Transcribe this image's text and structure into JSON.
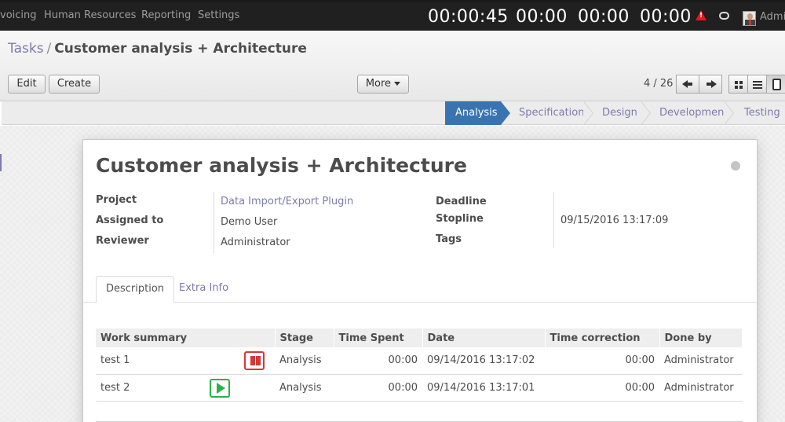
{
  "topbar": {
    "menus": [
      "voicing",
      "Human Resources",
      "Reporting",
      "Settings"
    ],
    "timers": [
      "00:00:45",
      "00:00",
      "00:00",
      "00:00"
    ],
    "user": "Admin"
  },
  "breadcrumb": {
    "parent": "Tasks",
    "separator": "/",
    "current": "Customer analysis + Architecture"
  },
  "toolbar": {
    "edit": "Edit",
    "create": "Create",
    "more": "More"
  },
  "pager": {
    "value": "4 / 26"
  },
  "stages": {
    "items": [
      "Analysis",
      "Specification",
      "Design",
      "Development",
      "Testing"
    ],
    "active": "Analysis"
  },
  "record": {
    "title": "Customer analysis + Architecture",
    "labels": {
      "project": "Project",
      "assigned": "Assigned to",
      "reviewer": "Reviewer",
      "deadline": "Deadline",
      "stopline": "Stopline",
      "tags": "Tags"
    },
    "values": {
      "project": "Data Import/Export Plugin",
      "assigned": "Demo User",
      "reviewer": "Administrator",
      "deadline": "",
      "stopline": "09/15/2016 13:17:09",
      "tags": ""
    }
  },
  "tabs": [
    "Description",
    "Extra Info"
  ],
  "works": {
    "headers": [
      "Work summary",
      "Stage",
      "Time Spent",
      "Date",
      "Time correction",
      "Done by"
    ],
    "rows": [
      {
        "summary": "test 1",
        "stage": "Analysis",
        "spent": "00:00",
        "date": "09/14/2016 13:17:02",
        "correction": "00:00",
        "done_by": "Administrator",
        "control": "pause-icon"
      },
      {
        "summary": "test 2",
        "stage": "Analysis",
        "spent": "00:00",
        "date": "09/14/2016 13:17:01",
        "correction": "00:00",
        "done_by": "Administrator",
        "control": "play-icon"
      }
    ]
  },
  "colors": {
    "accent": "#7c7bad",
    "active_stage": "#3a74b0",
    "pause": "#d43838",
    "play": "#2cb14a",
    "warning": "#e01b1b"
  }
}
